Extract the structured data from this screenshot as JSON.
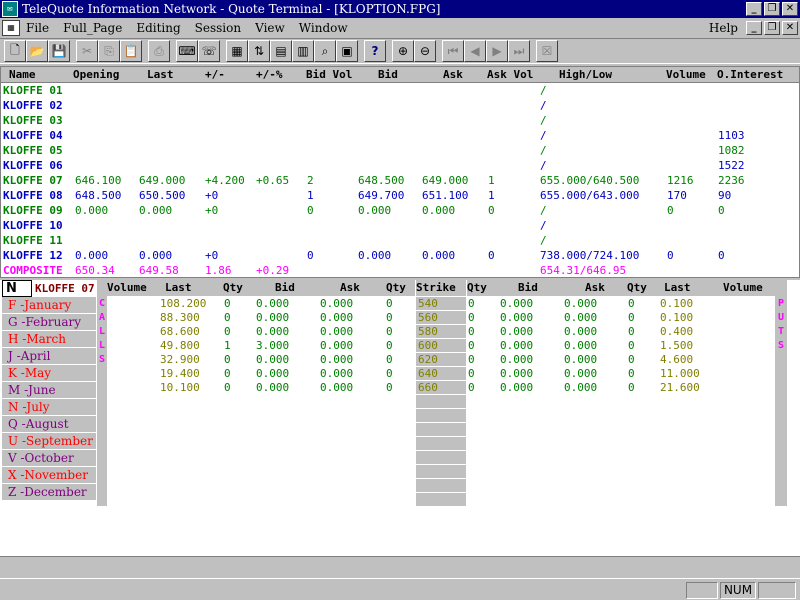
{
  "window": {
    "title": "TeleQuote Information Network - Quote Terminal - [KLOPTION.FPG]",
    "min": "_",
    "max": "❐",
    "close": "✕"
  },
  "menu": {
    "items": [
      "File",
      "Full_Page",
      "Editing",
      "Session",
      "View",
      "Window"
    ],
    "help": "Help"
  },
  "quote": {
    "headers": [
      "Name",
      "Opening",
      "Last",
      "+/-",
      "+/-%",
      "Bid Vol",
      "Bid",
      "Ask",
      "Ask Vol",
      "High/Low",
      "Volume",
      "O.Interest"
    ],
    "rows": [
      {
        "name": "KLOFFE 01",
        "open": "",
        "last": "",
        "chg": "",
        "pct": "",
        "bidvol": "",
        "bid": "",
        "ask": "",
        "askvol": "",
        "hl": "/",
        "vol": "",
        "oi": "",
        "color": "#008000"
      },
      {
        "name": "KLOFFE 02",
        "open": "",
        "last": "",
        "chg": "",
        "pct": "",
        "bidvol": "",
        "bid": "",
        "ask": "",
        "askvol": "",
        "hl": "/",
        "vol": "",
        "oi": "",
        "color": "#0000c0"
      },
      {
        "name": "KLOFFE 03",
        "open": "",
        "last": "",
        "chg": "",
        "pct": "",
        "bidvol": "",
        "bid": "",
        "ask": "",
        "askvol": "",
        "hl": "/",
        "vol": "",
        "oi": "",
        "color": "#008000"
      },
      {
        "name": "KLOFFE 04",
        "open": "",
        "last": "",
        "chg": "",
        "pct": "",
        "bidvol": "",
        "bid": "",
        "ask": "",
        "askvol": "",
        "hl": "/",
        "vol": "",
        "oi": "1103",
        "color": "#0000c0"
      },
      {
        "name": "KLOFFE 05",
        "open": "",
        "last": "",
        "chg": "",
        "pct": "",
        "bidvol": "",
        "bid": "",
        "ask": "",
        "askvol": "",
        "hl": "/",
        "vol": "",
        "oi": "1082",
        "color": "#008000"
      },
      {
        "name": "KLOFFE 06",
        "open": "",
        "last": "",
        "chg": "",
        "pct": "",
        "bidvol": "",
        "bid": "",
        "ask": "",
        "askvol": "",
        "hl": "/",
        "vol": "",
        "oi": "1522",
        "color": "#0000c0"
      },
      {
        "name": "KLOFFE 07",
        "open": "646.100",
        "last": "649.000",
        "chg": "+4.200",
        "pct": "+0.65",
        "bidvol": "2",
        "bid": "648.500",
        "ask": "649.000",
        "askvol": "1",
        "hl": "655.000/640.500",
        "vol": "1216",
        "oi": "2236",
        "color": "#008000"
      },
      {
        "name": "KLOFFE 08",
        "open": "648.500",
        "last": "650.500",
        "chg": "+0",
        "pct": "",
        "bidvol": "1",
        "bid": "649.700",
        "ask": "651.100",
        "askvol": "1",
        "hl": "655.000/643.000",
        "vol": "170",
        "oi": "90",
        "color": "#0000c0"
      },
      {
        "name": "KLOFFE 09",
        "open": "0.000",
        "last": "0.000",
        "chg": "+0",
        "pct": "",
        "bidvol": "0",
        "bid": "0.000",
        "ask": "0.000",
        "askvol": "0",
        "hl": "/",
        "vol": "0",
        "oi": "0",
        "color": "#008000"
      },
      {
        "name": "KLOFFE 10",
        "open": "",
        "last": "",
        "chg": "",
        "pct": "",
        "bidvol": "",
        "bid": "",
        "ask": "",
        "askvol": "",
        "hl": "/",
        "vol": "",
        "oi": "",
        "color": "#0000c0"
      },
      {
        "name": "KLOFFE 11",
        "open": "",
        "last": "",
        "chg": "",
        "pct": "",
        "bidvol": "",
        "bid": "",
        "ask": "",
        "askvol": "",
        "hl": "/",
        "vol": "",
        "oi": "",
        "color": "#008000"
      },
      {
        "name": "KLOFFE 12",
        "open": "0.000",
        "last": "0.000",
        "chg": "+0",
        "pct": "",
        "bidvol": "0",
        "bid": "0.000",
        "ask": "0.000",
        "askvol": "0",
        "hl": "738.000/724.100",
        "vol": "0",
        "oi": "0",
        "color": "#0000c0"
      },
      {
        "name": "COMPOSITE",
        "open": "650.34",
        "last": "649.58",
        "chg": "1.86",
        "pct": "+0.29",
        "bidvol": "",
        "bid": "",
        "ask": "",
        "askvol": "",
        "hl": "654.31/646.95",
        "vol": "",
        "oi": "",
        "color": "#ff00ff"
      }
    ]
  },
  "options": {
    "symbol_input": "N",
    "symbol_name": "KLOFFE 07",
    "calls_label": "CALLS",
    "puts_label": "PUTS",
    "months": [
      {
        "code": "F",
        "name": "-January",
        "color": "#ff0000"
      },
      {
        "code": "G",
        "name": "-February",
        "color": "#800080"
      },
      {
        "code": "H",
        "name": "-March",
        "color": "#ff0000"
      },
      {
        "code": "J",
        "name": "-April",
        "color": "#800080"
      },
      {
        "code": "K",
        "name": "-May",
        "color": "#ff0000"
      },
      {
        "code": "M",
        "name": "-June",
        "color": "#800080"
      },
      {
        "code": "N",
        "name": "-July",
        "color": "#ff0000"
      },
      {
        "code": "Q",
        "name": "-August",
        "color": "#800080"
      },
      {
        "code": "U",
        "name": "-September",
        "color": "#ff0000"
      },
      {
        "code": "V",
        "name": "-October",
        "color": "#800080"
      },
      {
        "code": "X",
        "name": "-November",
        "color": "#ff0000"
      },
      {
        "code": "Z",
        "name": "-December",
        "color": "#800080"
      }
    ],
    "call_headers": [
      "Volume",
      "Last",
      "Qty",
      "Bid",
      "Ask",
      "Qty"
    ],
    "strike_header": "Strike",
    "put_headers": [
      "Qty",
      "Bid",
      "Ask",
      "Qty",
      "Last",
      "Volume"
    ],
    "rows": [
      {
        "c_last": "108.200",
        "c_qty": "0",
        "c_bid": "0.000",
        "c_ask": "0.000",
        "c_aqty": "0",
        "strike": "540",
        "p_qty": "0",
        "p_bid": "0.000",
        "p_ask": "0.000",
        "p_aqty": "0",
        "p_last": "0.100"
      },
      {
        "c_last": "88.300",
        "c_qty": "0",
        "c_bid": "0.000",
        "c_ask": "0.000",
        "c_aqty": "0",
        "strike": "560",
        "p_qty": "0",
        "p_bid": "0.000",
        "p_ask": "0.000",
        "p_aqty": "0",
        "p_last": "0.100"
      },
      {
        "c_last": "68.600",
        "c_qty": "0",
        "c_bid": "0.000",
        "c_ask": "0.000",
        "c_aqty": "0",
        "strike": "580",
        "p_qty": "0",
        "p_bid": "0.000",
        "p_ask": "0.000",
        "p_aqty": "0",
        "p_last": "0.400"
      },
      {
        "c_last": "49.800",
        "c_qty": "1",
        "c_bid": "3.000",
        "c_ask": "0.000",
        "c_aqty": "0",
        "strike": "600",
        "p_qty": "0",
        "p_bid": "0.000",
        "p_ask": "0.000",
        "p_aqty": "0",
        "p_last": "1.500"
      },
      {
        "c_last": "32.900",
        "c_qty": "0",
        "c_bid": "0.000",
        "c_ask": "0.000",
        "c_aqty": "0",
        "strike": "620",
        "p_qty": "0",
        "p_bid": "0.000",
        "p_ask": "0.000",
        "p_aqty": "0",
        "p_last": "4.600"
      },
      {
        "c_last": "19.400",
        "c_qty": "0",
        "c_bid": "0.000",
        "c_ask": "0.000",
        "c_aqty": "0",
        "strike": "640",
        "p_qty": "0",
        "p_bid": "0.000",
        "p_ask": "0.000",
        "p_aqty": "0",
        "p_last": "11.000"
      },
      {
        "c_last": "10.100",
        "c_qty": "0",
        "c_bid": "0.000",
        "c_ask": "0.000",
        "c_aqty": "0",
        "strike": "660",
        "p_qty": "0",
        "p_bid": "0.000",
        "p_ask": "0.000",
        "p_aqty": "0",
        "p_last": "21.600"
      }
    ],
    "colors": {
      "last": "#808000",
      "qty": "#008000",
      "strike": "#808000"
    }
  },
  "status": {
    "num": "NUM"
  }
}
